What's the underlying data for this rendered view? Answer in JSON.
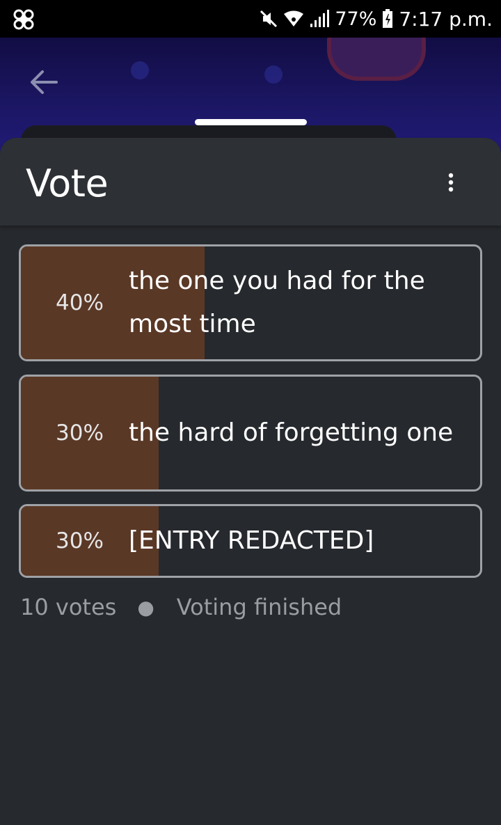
{
  "status_bar": {
    "battery": "77%",
    "time": "7:17 p.m."
  },
  "colors": {
    "sheet_background": "#26292d",
    "result_fill": "#5a3826",
    "option_border": "#9fa2a6"
  },
  "poll": {
    "title": "Vote",
    "options": [
      {
        "percent": "40%",
        "fraction": 0.4,
        "label": "the one you had for the most time"
      },
      {
        "percent": "30%",
        "fraction": 0.3,
        "label": "the hard of forgetting one"
      },
      {
        "percent": "30%",
        "fraction": 0.3,
        "label": "[ENTRY REDACTED]"
      }
    ],
    "votes": "10 votes",
    "status": "Voting finished"
  }
}
